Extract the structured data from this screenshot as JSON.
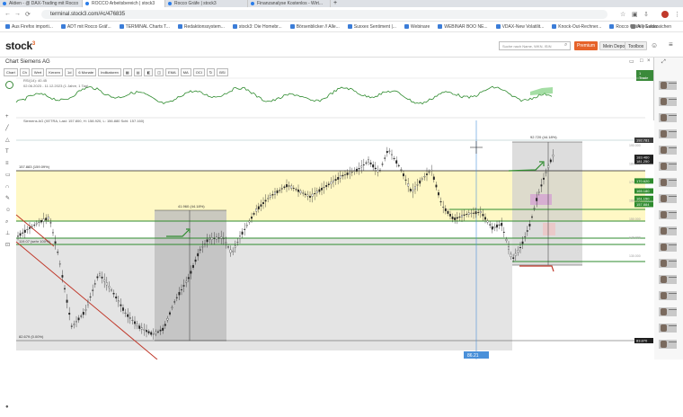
{
  "browser": {
    "tabs": [
      {
        "label": "Aktien - @ DAX-Trading mit Rocco"
      },
      {
        "label": "ROCCO Arbeitsbereich | stock3",
        "active": true
      },
      {
        "label": "Rocco Gräfe | stock3"
      },
      {
        "label": "Finanzanalyse Kostenlos - Wirt..."
      }
    ],
    "url": "terminal.stock3.com/#c/476835",
    "bookmarks": [
      "Aus Firefox importi...",
      "ADT mit Rocco Gräf...",
      "TERMINAL Charts T...",
      "Redaktionssystem...",
      "stock3: Die Homebr...",
      "Börsenblicker // Alle...",
      "Suxxex Sentiment |...",
      "Webinare",
      "WEBINAR BOO NE...",
      "VDAX-New Volatilit...",
      "Knock-Out-Rechner...",
      "Rocco Gräfe | Gulda..."
    ],
    "bookmarks_right": "Alle Lesezeichen"
  },
  "app": {
    "logo": "stock",
    "logo_sup": "3",
    "search_placeholder": "Suche nach Name, WKN, ISIN",
    "premium": "Premium",
    "depot": "Mein Depot",
    "toolbox": "Toolbox"
  },
  "chart_window": {
    "title": "Chart Siemens AG",
    "toolbar": [
      "Chart",
      "Ch",
      "Wert",
      "Kerzen",
      "1d",
      "6 Monate",
      "Indikatoren",
      "",
      "",
      "",
      "",
      "EMA",
      "MA",
      "OCI",
      "",
      "BSI"
    ],
    "trade": "1 Trade",
    "rsi_label": "RSI(14): 40.45",
    "rsi_sub": "02.06.2023 - 11.12.2023 (1 Jahre, 1 Tag)",
    "main_label": "Siemens AG (XETRA, Last: 157.800, H: 158.920, L: 156.880 Schl: 157.160)",
    "top_annotation": "92.720 (44.18%)",
    "left_annotation": "41.960 (44.18%)",
    "level_left_label": "157.883 (159.09%)",
    "low_left_label": "119.07 (sehr 100%)",
    "bottom_left_label": "82.679 (0.00%)",
    "cursor_readout": "86.21"
  },
  "price_axis": {
    "tags": [
      {
        "label": "192.781",
        "price": 192.78,
        "bg": "#3d3d3d"
      },
      {
        "label": "183.460",
        "price": 183.46,
        "bg": "#1f1f1f"
      },
      {
        "label": "181.250",
        "price": 181.25,
        "bg": "#1f1f1f"
      },
      {
        "label": "170.620",
        "price": 170.62,
        "bg": "#2e8b2e"
      },
      {
        "label": "165.180",
        "price": 165.18,
        "bg": "#2e8b2e"
      },
      {
        "label": "161.150",
        "price": 161.15,
        "bg": "#2e8b2e"
      },
      {
        "label": "157.884",
        "price": 157.88,
        "bg": "#2e8b2e"
      },
      {
        "label": "83.870",
        "price": 83.87,
        "bg": "#1f1f1f"
      }
    ],
    "ticks": [
      "190.000",
      "180.000",
      "170.000",
      "160.000",
      "150.000",
      "140.000",
      "130.000"
    ]
  },
  "colors": {
    "support_green": "#2e8b2e",
    "yellow_zone": "#fff8c5",
    "gray_zone": "#d8d8d8",
    "downtrend_red": "#c0392b",
    "cursor_blue": "#4a90d9"
  }
}
